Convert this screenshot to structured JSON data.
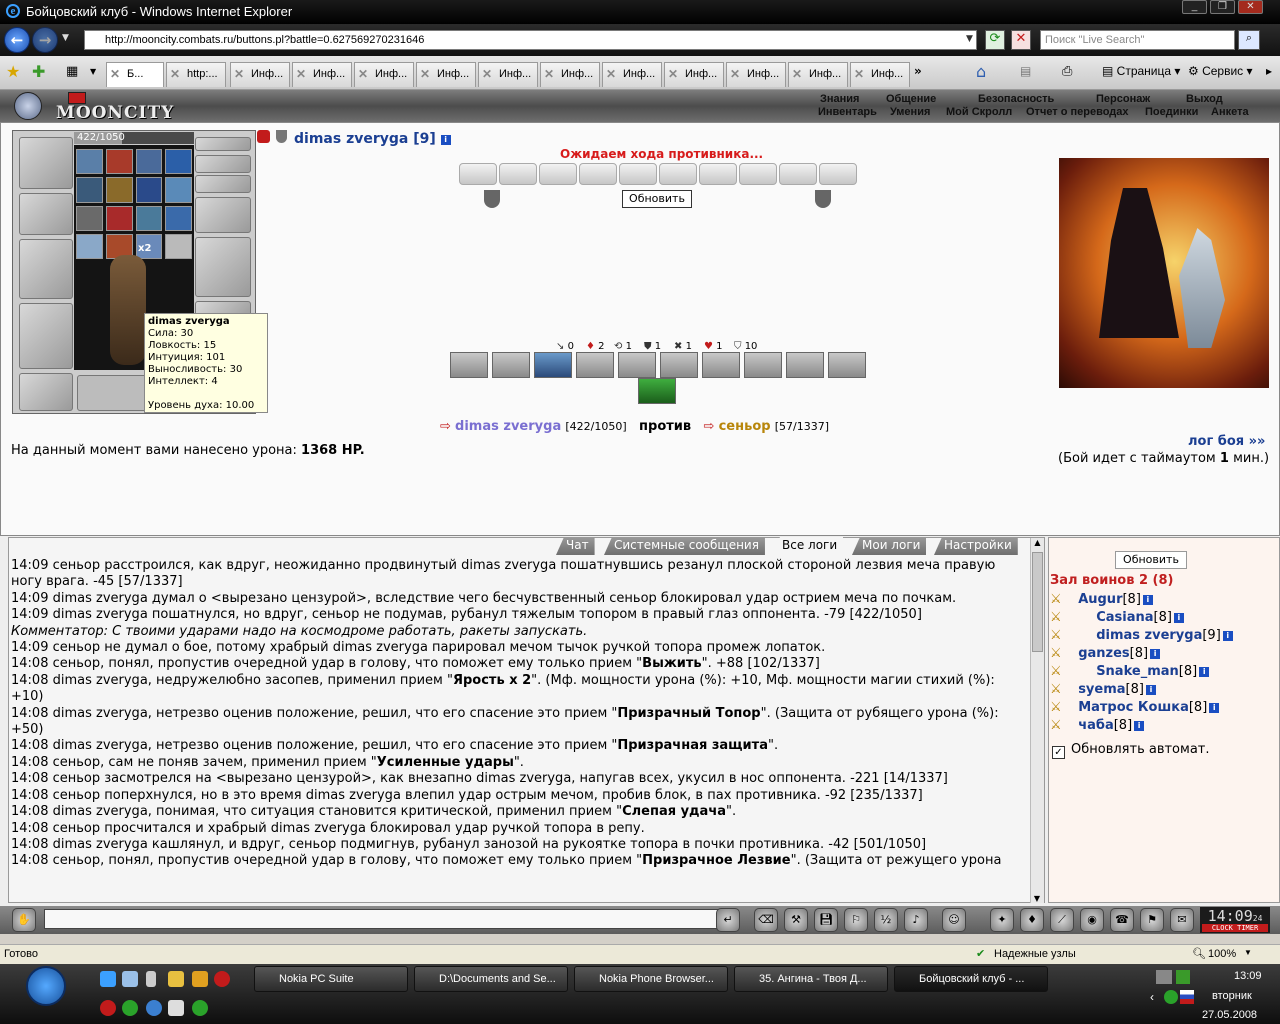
{
  "window": {
    "title": "Бойцовский клуб - Windows Internet Explorer"
  },
  "browser": {
    "url": "http://mooncity.combats.ru/buttons.pl?battle=0.627569270231646",
    "search_placeholder": "Поиск \"Live Search\"",
    "tabs": [
      "Б...",
      "http:...",
      "Инф...",
      "Инф...",
      "Инф...",
      "Инф...",
      "Инф...",
      "Инф...",
      "Инф...",
      "Инф...",
      "Инф...",
      "Инф...",
      "Инф..."
    ],
    "toolbar": {
      "page": "Страница",
      "service": "Сервис"
    },
    "status": "Готово",
    "zone": "Надежные узлы",
    "zoom": "100%"
  },
  "game": {
    "logo": "MOONCITY",
    "menu_top": [
      "Знания",
      "Общение",
      "Безопасность",
      "Персонаж",
      "Выход"
    ],
    "menu_bottom": [
      "Инвентарь",
      "Умения",
      "Мой Скролл",
      "Отчет о переводах",
      "Поединки",
      "Анкета"
    ],
    "hp_text": "422/1050",
    "hp_fraction": 0.402,
    "multiplier": "x2",
    "player_name": "dimas zveryga [9]",
    "tooltip": {
      "name": "dimas zveryga",
      "lines": [
        "Сила: 30",
        "Ловкость: 15",
        "Интуиция: 101",
        "Выносливость: 30",
        "Интеллект: 4"
      ],
      "spirit": "Уровень духа: 10.00"
    },
    "waiting": "Ожидаем хода противника...",
    "refresh_label": "Обновить",
    "stats": [
      "0",
      "2",
      "1",
      "1",
      "1",
      "1",
      "10"
    ],
    "vs": {
      "left_name": "dimas zveryga",
      "left_hp": "[422/1050]",
      "word": "против",
      "right_name": "сеньор",
      "right_hp": "[57/1337]"
    },
    "damage_text": "На данный момент вами нанесено урона:",
    "damage_value": "1368 HP.",
    "log_link": "лог боя »»",
    "timeout_prefix": "(Бой идет с таймаутом",
    "timeout_value": "1",
    "timeout_suffix": "мин.)"
  },
  "chat": {
    "tabs": [
      "Чат",
      "Системные сообщения",
      "Все логи",
      "Мои логи",
      "Настройки"
    ],
    "lines": [
      "14:09 ▢▢▣▣ сеньор расстроился, как вдруг, неожиданно продвинутый dimas zveryga пошатнувшись резанул плоской стороной лезвия меча правую ногу врага. -45 [57/1337]",
      "14:09 ▢▢▣▢ dimas zveryga думал о <вырезано цензурой>, вследствие чего бесчувственный сеньор блокировал удар острием меча по почкам.",
      "14:09 ▣▢▢▢ dimas zveryga пошатнулся, но вдруг, сеньор не подумав, рубанул тяжелым топором в правый глаз оппонента. -79 [422/1050]",
      "Комментатор: С твоими ударами надо на космодроме работать, ракеты запускать.",
      "14:09 ▢▣▢▢ сеньор не думал о бое, потому храбрый dimas zveryga парировал мечом тычок ручкой топора промеж лопаток.",
      "14:08 сеньор, понял, пропустив очередной удар в голову, что поможет ему только прием \"Выжить\". +88 [102/1337]",
      "14:08 dimas zveryga, недружелюбно засопев, применил прием \"Ярость x 2\". (Мф. мощности урона (%): +10, Мф. мощности магии стихий (%): +10)",
      "14:08 dimas zveryga, нетрезво оценив положение, решил, что его спасение это прием \"Призрачный Топор\". (Защита от рубящего урона (%): +50)",
      "14:08 dimas zveryga, нетрезво оценив положение, решил, что его спасение это прием \"Призрачная защита\".",
      "14:08 сеньор, сам не поняв зачем, применил прием \"Усиленные удары\".",
      "14:08 ▢▢▢▣ сеньор засмотрелся на <вырезано цензурой>, как внезапно dimas zveryga, напугав всех, укусил в нос оппонента. -221 [14/1337]",
      "14:08 ▢▢▣▢ сеньор поперхнулся, но в это время dimas zveryga влепил удар острым мечом, пробив блок, в пах противника. -92 [235/1337]",
      "14:08 dimas zveryga, понимая, что ситуация становится критической, применил прием \"Слепая удача\".",
      "14:08 ▣▢▢▢ сеньор просчитался и храбрый dimas zveryga блокировал удар ручкой топора в репу.",
      "14:08 ▢▢▣▢ dimas zveryga кашлянул, и вдруг, сеньор подмигнув, рубанул занозой на рукоятке топора в почки противника. -42 [501/1050]",
      "14:08 сеньор, понял, пропустив очередной удар в голову, что поможет ему только прием \"Призрачное Лезвие\". (Защита от режущего урона"
    ]
  },
  "hall": {
    "refresh": "Обновить",
    "title": "Зал воинов 2 (8)",
    "players": [
      {
        "name": "Augur",
        "level": "[8]"
      },
      {
        "name": "Casiana",
        "level": "[8]"
      },
      {
        "name": "dimas zveryga",
        "level": "[9]"
      },
      {
        "name": "ganzes",
        "level": "[8]"
      },
      {
        "name": "Snake_man",
        "level": "[8]"
      },
      {
        "name": "syema",
        "level": "[8]"
      },
      {
        "name": "Матрос Кошка",
        "level": "[8]"
      },
      {
        "name": "чаба",
        "level": "[8]"
      }
    ],
    "auto_update": "Обновлять автомат."
  },
  "clock": {
    "time": "14:09",
    "seconds": "24",
    "label": "CLOCK TIMER"
  },
  "taskbar": {
    "tasks": [
      "Nokia PC Suite",
      "D:\\Documents and Se...",
      "Nokia Phone Browser...",
      "35. Ангина - Твоя Д...",
      "Бойцовский клуб - ..."
    ],
    "time": "13:09",
    "day": "вторник",
    "date": "27.05.2008"
  },
  "colors": {
    "player": "#1b3f92",
    "enemy": "#b8860b",
    "damage": "#d41a1a",
    "waiting": "#d71b1b"
  }
}
